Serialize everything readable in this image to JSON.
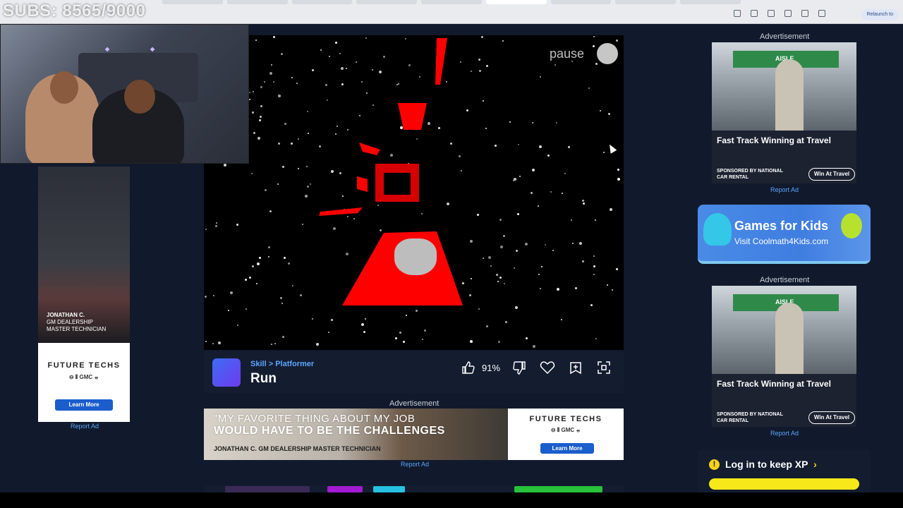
{
  "overlay": {
    "subs_counter": "SUBS: 8565/9000"
  },
  "browser": {
    "relaunch_label": "Relaunch to"
  },
  "game": {
    "pause_label": "pause",
    "category": "Skill",
    "breadcrumb_sep": ">",
    "subcategory": "Platformer",
    "title": "Run",
    "rating": "91%",
    "icons": [
      "thumbs-up-icon",
      "thumbs-down-icon",
      "heart-icon",
      "add-to-playlist-icon",
      "fullscreen-icon"
    ]
  },
  "ads": {
    "label": "Advertisement",
    "report": "Report Ad",
    "left": {
      "name": "JONATHAN C.",
      "role_line1": "GM DEALERSHIP",
      "role_line2": "MASTER TECHNICIAN",
      "brand": "FUTURE TECHS",
      "logos": "⊖ ⦀ GMC ⦵",
      "cta": "Learn More"
    },
    "middle": {
      "quote_line1": "\"MY FAVORITE THING ABOUT MY JOB",
      "quote_line2": "WOULD HAVE TO BE THE CHALLENGES",
      "credit": "JONATHAN C. GM DEALERSHIP MASTER TECHNICIAN",
      "brand": "FUTURE TECHS",
      "logos": "⊖ ⦀ GMC ⦵",
      "cta": "Learn More"
    },
    "right_top": {
      "sign": "AISLE",
      "title": "Fast Track Winning at Travel",
      "sponsor": "SPONSORED BY NATIONAL CAR RENTAL",
      "cta": "Win At Travel"
    },
    "right_bottom": {
      "sign": "AISLE",
      "title": "Fast Track Winning at Travel",
      "sponsor": "SPONSORED BY NATIONAL CAR RENTAL",
      "cta": "Win At Travel"
    }
  },
  "promo": {
    "title": "Games for Kids",
    "subtitle": "Visit Coolmath4Kids.com"
  },
  "login": {
    "icon": "!",
    "text": "Log in to keep XP",
    "chevron": "›"
  },
  "colors": {
    "page_bg": "#111a2c",
    "panel_bg": "#141d30",
    "link_blue": "#5aa6ff",
    "game_red": "#ff0000",
    "xp_yellow": "#f7e81a"
  }
}
